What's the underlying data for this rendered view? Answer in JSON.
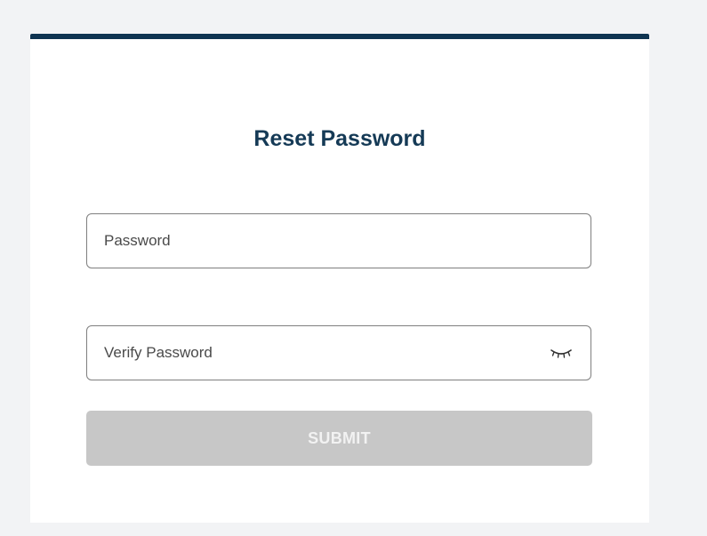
{
  "form": {
    "title": "Reset Password",
    "password_field": {
      "placeholder": "Password",
      "value": ""
    },
    "verify_field": {
      "placeholder": "Verify Password",
      "value": "",
      "visibility_icon": "eye-closed-icon"
    },
    "submit_label": "SUBMIT"
  },
  "colors": {
    "accent_bar": "#0f3451",
    "title": "#153a56",
    "submit_disabled_bg": "#c7c7c7",
    "submit_disabled_text": "#f2f2f2",
    "page_bg": "#f2f3f5"
  }
}
